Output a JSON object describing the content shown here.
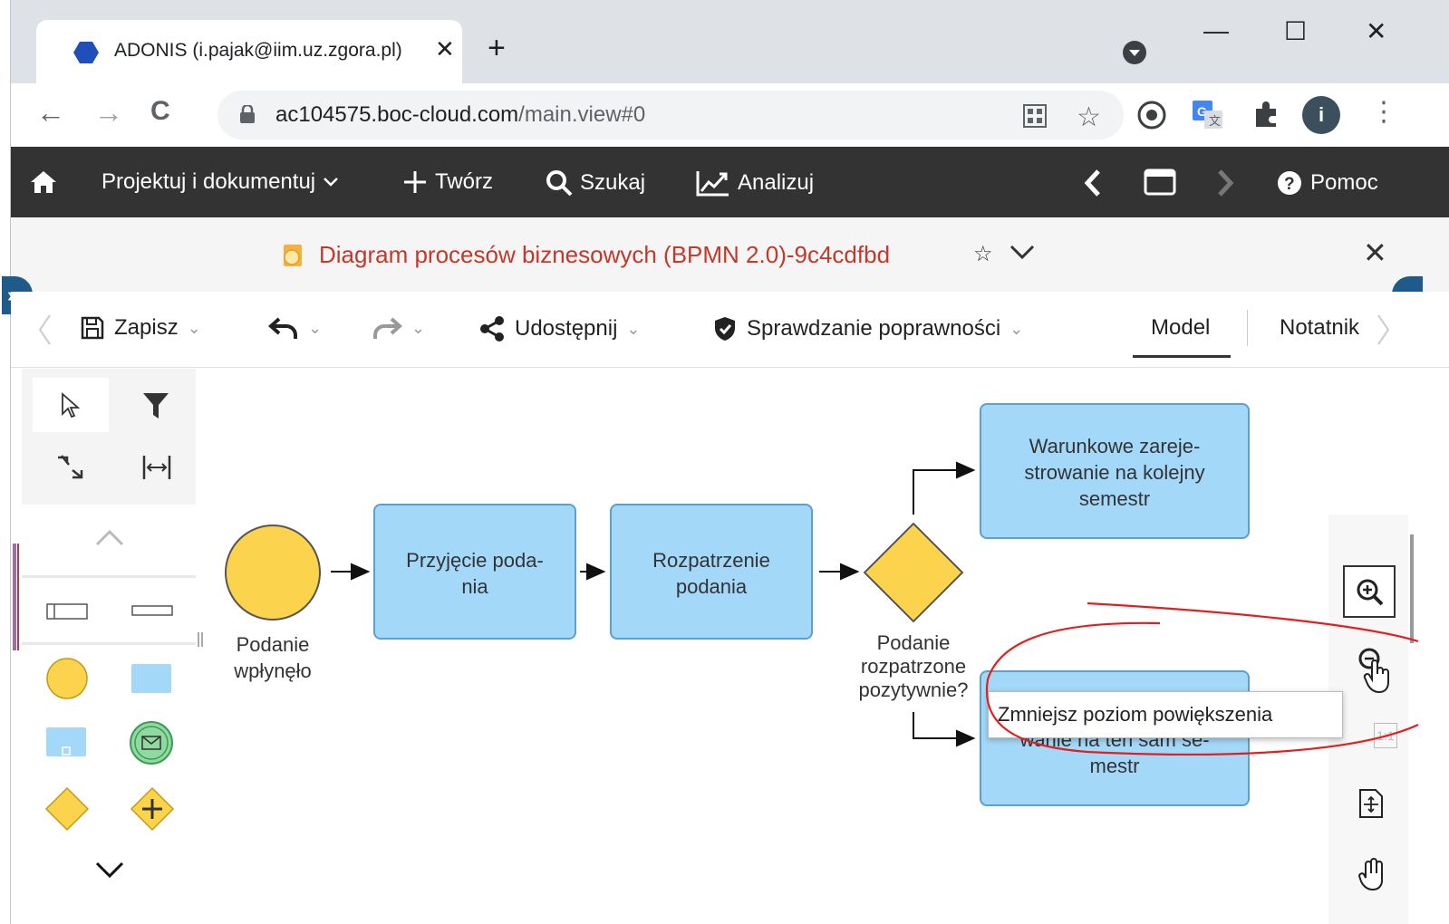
{
  "browser": {
    "tab_title": "ADONIS (i.pajak@iim.uz.zgora.pl)",
    "tab_close": "✕",
    "new_tab": "+",
    "win_minimize": "—",
    "win_maximize": "☐",
    "win_close": "✕",
    "nav_back": "←",
    "nav_forward": "→",
    "nav_reload": "C",
    "url_host": "ac104575.boc-cloud.com",
    "url_path": "/main.view#0",
    "bookmark_star": "☆",
    "avatar_letter": "i",
    "menu": "⋮"
  },
  "appnav": {
    "home_icon": "home-icon",
    "design": "Projektuj i dokumentuj",
    "create": "Twórz",
    "search": "Szukaj",
    "analyze": "Analizuj",
    "help": "Pomoc"
  },
  "document": {
    "title": "Diagram procesów biznesowych (BPMN 2.0)-9c4cdfbd",
    "favorite": "☆",
    "close": "✕",
    "icon": "bpmn-document-icon"
  },
  "editor_toolbar": {
    "save": "Zapisz",
    "share": "Udostępnij",
    "validate": "Sprawdzanie poprawności",
    "tab_model": "Model",
    "tab_notebook": "Notatnik"
  },
  "diagram": {
    "start_event_label": [
      "Podanie",
      "wpłynęło"
    ],
    "task1": [
      "Przyjęcie poda-",
      "nia"
    ],
    "task2": [
      "Rozpatrzenie",
      "podania"
    ],
    "gateway_label": [
      "Podanie",
      "rozpatrzone",
      "pozytywnie?"
    ],
    "task_top": [
      "Warunkowe zareje-",
      "strowanie na kolejny",
      "semestr"
    ],
    "task_bottom_partial": [
      "wanie na ten sam se-",
      "mestr"
    ],
    "colors": {
      "task_fill": "#a3d8f8",
      "task_border": "#5aa0d0",
      "event_fill": "#fcd34d",
      "gateway_fill": "#fcd34d",
      "annotation": "#e02020"
    }
  },
  "zoom": {
    "tooltip": "Zmniejsz poziom powiększenia",
    "one_to_one": "1:1"
  }
}
